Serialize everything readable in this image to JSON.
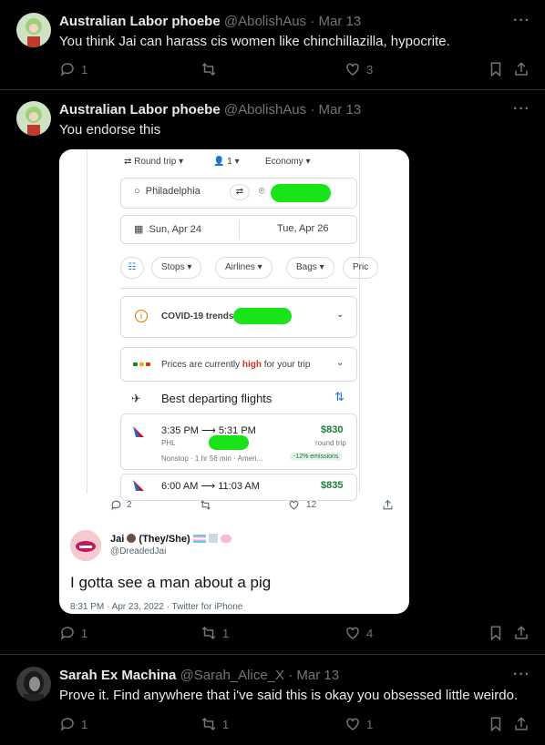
{
  "tweets": [
    {
      "name": "Australian Labor phoebe",
      "handle": "@AbolishAus",
      "dot": "·",
      "date": "Mar 13",
      "text": "You think Jai can harass cis women like chinchillazilla, hypocrite.",
      "replies": "1",
      "retweets": "",
      "likes": "3"
    },
    {
      "name": "Australian Labor phoebe",
      "handle": "@AbolishAus",
      "dot": "·",
      "date": "Mar 13",
      "text": "You endorse this",
      "replies": "1",
      "retweets": "1",
      "likes": "4"
    },
    {
      "name": "Sarah Ex Machina",
      "handle": "@Sarah_Alice_X",
      "dot": "·",
      "date": "Mar 13",
      "text": "Prove it. Find anywhere that i've said this is okay you obsessed little weirdo.",
      "replies": "1",
      "retweets": "1",
      "likes": "1"
    }
  ],
  "more_glyph": "···",
  "embed": {
    "flights": {
      "trip_type": "Round trip",
      "passengers": "1",
      "cabin": "Economy",
      "origin": "Philadelphia",
      "depart_date": "Sun, Apr 24",
      "return_date": "Tue, Apr 26",
      "filters": [
        "Stops",
        "Airlines",
        "Bags",
        "Pric"
      ],
      "covid_label": "COVID-19 trends i",
      "prices_prefix": "Prices are currently ",
      "prices_high": "high",
      "prices_suffix": " for your trip",
      "best_title": "Best departing flights",
      "flight1": {
        "depart": "3:35 PM",
        "arrive": "5:31 PM",
        "price": "$830",
        "from": "PHL",
        "trip": "round trip",
        "stops": "Nonstop",
        "duration": "1 hr 56 min",
        "airline": "Ameri...",
        "emissions": "-12% emissions"
      },
      "flight2": {
        "depart": "6:00 AM",
        "arrive": "11:03 AM",
        "price": "$835"
      },
      "colors": {
        "price_green": "#188038",
        "high_red": "#d93025",
        "blue": "#1a73e8",
        "redact": "#19e319"
      }
    },
    "inner_actions": {
      "replies": "2",
      "likes": "12"
    },
    "quoted": {
      "name": "Jai",
      "pronouns": "(They/She)",
      "handle": "@DreadedJai",
      "text": "I gotta see a man about a pig",
      "meta": "8:31 PM · Apr 23, 2022 · Twitter for iPhone"
    }
  }
}
